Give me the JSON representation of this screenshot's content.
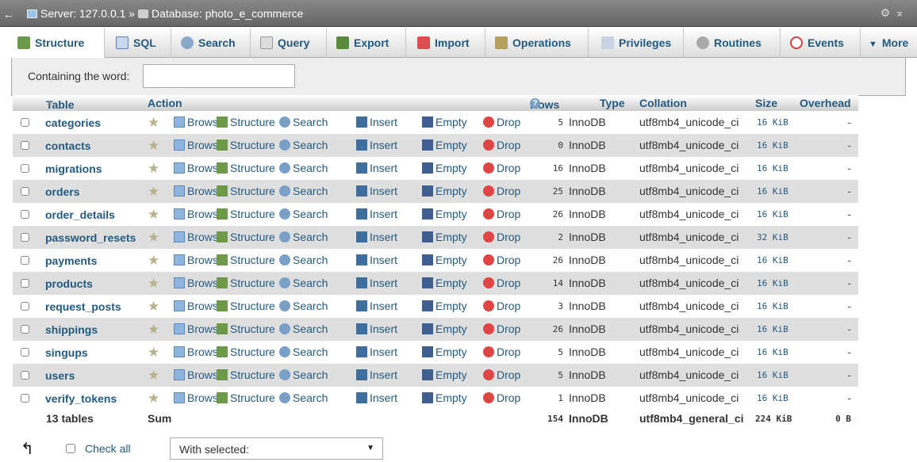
{
  "breadcrumb": {
    "server": "Server: 127.0.0.1",
    "separator": "»",
    "database": "Database: photo_e_commerce"
  },
  "tabs": [
    {
      "label": "Structure",
      "icon": "structure-icon",
      "active": true
    },
    {
      "label": "SQL",
      "icon": "sql-icon"
    },
    {
      "label": "Search",
      "icon": "search-icon"
    },
    {
      "label": "Query",
      "icon": "query-icon"
    },
    {
      "label": "Export",
      "icon": "export-icon"
    },
    {
      "label": "Import",
      "icon": "import-icon"
    },
    {
      "label": "Operations",
      "icon": "operations-icon"
    },
    {
      "label": "Privileges",
      "icon": "privileges-icon"
    },
    {
      "label": "Routines",
      "icon": "routines-icon"
    },
    {
      "label": "Events",
      "icon": "events-icon"
    },
    {
      "label": "More",
      "icon": "chevron-down-icon"
    }
  ],
  "filter": {
    "label": "Containing the word:",
    "value": ""
  },
  "table": {
    "headers": {
      "table": "Table",
      "sort_indicator": "▲",
      "action": "Action",
      "rows": "Rows",
      "type": "Type",
      "collation": "Collation",
      "size": "Size",
      "overhead": "Overhead"
    },
    "actions": [
      "Browse",
      "Structure",
      "Search",
      "Insert",
      "Empty",
      "Drop"
    ],
    "rows": [
      {
        "name": "categories",
        "rows": "5",
        "type": "InnoDB",
        "collation": "utf8mb4_unicode_ci",
        "size": "16 KiB",
        "overhead": "-"
      },
      {
        "name": "contacts",
        "rows": "0",
        "type": "InnoDB",
        "collation": "utf8mb4_unicode_ci",
        "size": "16 KiB",
        "overhead": "-"
      },
      {
        "name": "migrations",
        "rows": "16",
        "type": "InnoDB",
        "collation": "utf8mb4_unicode_ci",
        "size": "16 KiB",
        "overhead": "-"
      },
      {
        "name": "orders",
        "rows": "25",
        "type": "InnoDB",
        "collation": "utf8mb4_unicode_ci",
        "size": "16 KiB",
        "overhead": "-"
      },
      {
        "name": "order_details",
        "rows": "26",
        "type": "InnoDB",
        "collation": "utf8mb4_unicode_ci",
        "size": "16 KiB",
        "overhead": "-"
      },
      {
        "name": "password_resets",
        "rows": "2",
        "type": "InnoDB",
        "collation": "utf8mb4_unicode_ci",
        "size": "32 KiB",
        "overhead": "-"
      },
      {
        "name": "payments",
        "rows": "26",
        "type": "InnoDB",
        "collation": "utf8mb4_unicode_ci",
        "size": "16 KiB",
        "overhead": "-"
      },
      {
        "name": "products",
        "rows": "14",
        "type": "InnoDB",
        "collation": "utf8mb4_unicode_ci",
        "size": "16 KiB",
        "overhead": "-"
      },
      {
        "name": "request_posts",
        "rows": "3",
        "type": "InnoDB",
        "collation": "utf8mb4_unicode_ci",
        "size": "16 KiB",
        "overhead": "-"
      },
      {
        "name": "shippings",
        "rows": "26",
        "type": "InnoDB",
        "collation": "utf8mb4_unicode_ci",
        "size": "16 KiB",
        "overhead": "-"
      },
      {
        "name": "singups",
        "rows": "5",
        "type": "InnoDB",
        "collation": "utf8mb4_unicode_ci",
        "size": "16 KiB",
        "overhead": "-"
      },
      {
        "name": "users",
        "rows": "5",
        "type": "InnoDB",
        "collation": "utf8mb4_unicode_ci",
        "size": "16 KiB",
        "overhead": "-"
      },
      {
        "name": "verify_tokens",
        "rows": "1",
        "type": "InnoDB",
        "collation": "utf8mb4_unicode_ci",
        "size": "16 KiB",
        "overhead": "-"
      }
    ],
    "summary": {
      "count": "13 tables",
      "label": "Sum",
      "rows": "154",
      "type": "InnoDB",
      "collation": "utf8mb4_general_ci",
      "size": "224 KiB",
      "overhead": "0 B"
    }
  },
  "bottom": {
    "check_all": "Check all",
    "with_selected": "With selected:"
  },
  "colors": {
    "link": "#235a81",
    "drop": "#e04545",
    "row_alt": "#dfdfdf"
  }
}
